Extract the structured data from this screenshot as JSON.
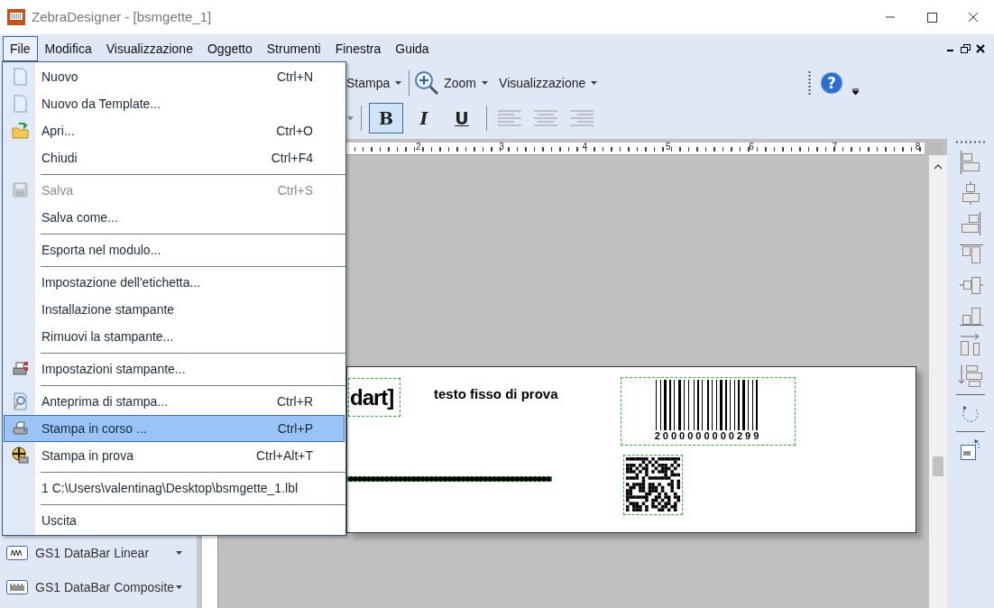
{
  "window": {
    "title": "ZebraDesigner - [bsmgette_1]"
  },
  "menubar": [
    {
      "label": "File",
      "selected": true
    },
    {
      "label": "Modifica",
      "selected": false
    },
    {
      "label": "Visualizzazione",
      "selected": false
    },
    {
      "label": "Oggetto",
      "selected": false
    },
    {
      "label": "Strumenti",
      "selected": false
    },
    {
      "label": "Finestra",
      "selected": false
    },
    {
      "label": "Guida",
      "selected": false
    }
  ],
  "file_menu": [
    [
      {
        "kind": "document",
        "label": "Nuovo",
        "shortcut": "Ctrl+N",
        "disabled": false,
        "selected": false
      },
      {
        "kind": "document",
        "label": "Nuovo da Template...",
        "disabled": false,
        "selected": false
      },
      {
        "kind": "folder",
        "label": "Apri...",
        "shortcut": "Ctrl+O",
        "disabled": false,
        "selected": false
      },
      {
        "kind": "plain",
        "label": "Chiudi",
        "shortcut": "Ctrl+F4",
        "disabled": false,
        "selected": false
      }
    ],
    [
      {
        "kind": "disk",
        "label": "Salva",
        "shortcut": "Ctrl+S",
        "disabled": true,
        "selected": false
      },
      {
        "kind": "plain",
        "label": "Salva come...",
        "disabled": false,
        "selected": false
      }
    ],
    [
      {
        "kind": "plain",
        "label": "Esporta nel modulo...",
        "disabled": false,
        "selected": false
      }
    ],
    [
      {
        "kind": "plain",
        "label": "Impostazione dell'etichetta...",
        "disabled": false,
        "selected": false
      },
      {
        "kind": "plain",
        "label": "Installazione stampante",
        "disabled": false,
        "selected": false
      },
      {
        "kind": "plain",
        "label": "Rimuovi la stampante...",
        "disabled": false,
        "selected": false
      }
    ],
    [
      {
        "kind": "printer-setup",
        "label": "Impostazioni stampante...",
        "disabled": false,
        "selected": false
      }
    ],
    [
      {
        "kind": "preview",
        "label": "Anteprima di stampa...",
        "shortcut": "Ctrl+R",
        "disabled": false,
        "selected": false
      },
      {
        "kind": "printer",
        "label": "Stampa in corso ...",
        "shortcut": "Ctrl+P",
        "disabled": false,
        "selected": true
      },
      {
        "kind": "test-print",
        "label": "Stampa in prova",
        "shortcut": "Ctrl+Alt+T",
        "disabled": false,
        "selected": false
      }
    ],
    [
      {
        "kind": "plain",
        "label": "1 C:\\Users\\valentinag\\Desktop\\bsmgette_1.lbl",
        "disabled": false,
        "selected": false
      }
    ],
    [
      {
        "kind": "plain",
        "label": "Uscita",
        "disabled": false,
        "selected": false
      }
    ]
  ],
  "toolbar": {
    "print": "Stampa",
    "zoom": "Zoom",
    "view": "Visualizzazione",
    "help": "?"
  },
  "format_buttons": [
    {
      "label": "B",
      "selected": true
    },
    {
      "label": "I",
      "selected": false
    },
    {
      "label": "U",
      "selected": false
    }
  ],
  "ruler": [
    "2",
    "3",
    "4",
    "5",
    "6",
    "7",
    "8"
  ],
  "object_panel": [
    "GS1 DataBar Linear",
    "GS1 DataBar Composite"
  ],
  "label": {
    "text_object": "dart]",
    "fixed_text": "testo fisso di prova",
    "barcode_number": "2000000000299"
  }
}
